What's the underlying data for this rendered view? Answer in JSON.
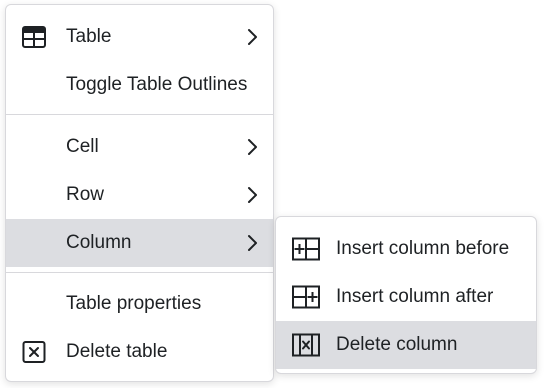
{
  "main_menu": {
    "items": [
      {
        "label": "Table",
        "icon": "table-icon",
        "has_submenu": true
      },
      {
        "label": "Toggle Table Outlines"
      },
      {
        "label": "Cell",
        "has_submenu": true
      },
      {
        "label": "Row",
        "has_submenu": true
      },
      {
        "label": "Column",
        "has_submenu": true,
        "active": true
      },
      {
        "label": "Table properties"
      },
      {
        "label": "Delete table",
        "icon": "delete-table-icon"
      }
    ]
  },
  "column_submenu": {
    "items": [
      {
        "label": "Insert column before",
        "icon": "insert-column-before-icon"
      },
      {
        "label": "Insert column after",
        "icon": "insert-column-after-icon"
      },
      {
        "label": "Delete column",
        "icon": "delete-column-icon",
        "active": true
      }
    ]
  },
  "colors": {
    "highlight": "#dcdde1",
    "text": "#1e2124",
    "border": "#d8d8dc"
  }
}
